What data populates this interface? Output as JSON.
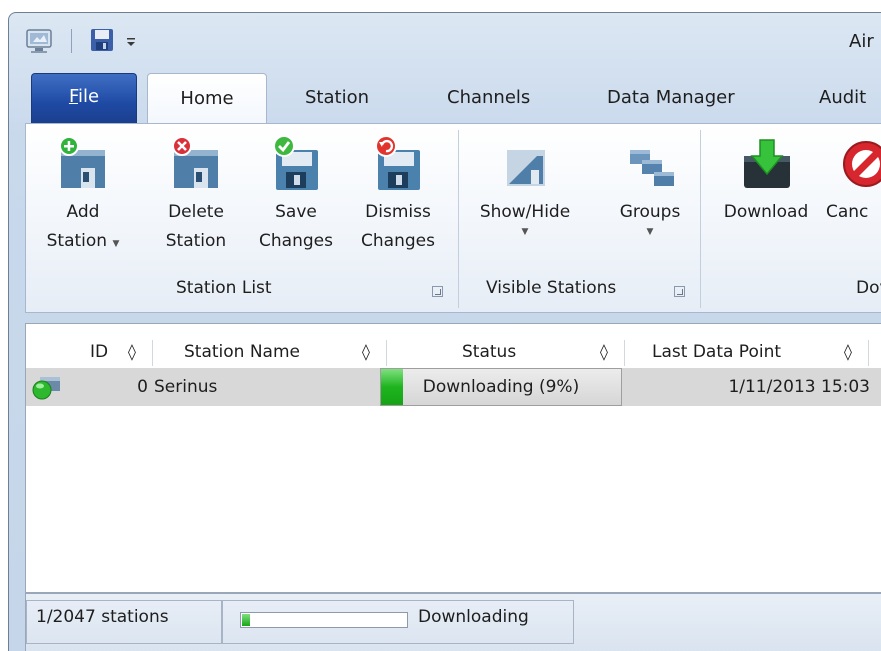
{
  "window": {
    "title": "Air"
  },
  "quick_access": {
    "icons": [
      "computer-icon",
      "save-icon",
      "customize-dropdown-icon"
    ]
  },
  "tabs": [
    {
      "label": "File",
      "underline": "F",
      "rest": "ile"
    },
    {
      "label": "Home",
      "selected": true
    },
    {
      "label": "Station"
    },
    {
      "label": "Channels"
    },
    {
      "label": "Data Manager"
    },
    {
      "label": "Audit"
    }
  ],
  "ribbon": {
    "groups": [
      {
        "label": "Station List",
        "buttons": [
          {
            "line1": "Add",
            "line2": "Station",
            "dropdown": true,
            "icon": "add-station-icon"
          },
          {
            "line1": "Delete",
            "line2": "Station",
            "icon": "delete-station-icon"
          },
          {
            "line1": "Save",
            "line2": "Changes",
            "icon": "save-changes-icon"
          },
          {
            "line1": "Dismiss",
            "line2": "Changes",
            "icon": "dismiss-changes-icon"
          }
        ]
      },
      {
        "label": "Visible Stations",
        "buttons": [
          {
            "line1": "Show/Hide",
            "dropdown": true,
            "icon": "show-hide-icon"
          },
          {
            "line1": "Groups",
            "dropdown": true,
            "icon": "groups-icon"
          }
        ]
      },
      {
        "label": "Dov",
        "buttons": [
          {
            "line1": "Download",
            "icon": "download-icon"
          },
          {
            "line1": "Canc",
            "icon": "cancel-icon"
          }
        ]
      }
    ]
  },
  "grid": {
    "columns": [
      "ID",
      "Station Name",
      "Status",
      "Last Data Point"
    ],
    "sort_glyph": "◊",
    "rows": [
      {
        "id": "0",
        "station_name": "Serinus",
        "status": "Downloading (9%)",
        "progress_percent": 9,
        "last_data_point": "1/11/2013 15:03",
        "status_color": "#2eb82e"
      }
    ]
  },
  "statusbar": {
    "stations": "1/2047 stations",
    "progress_percent": 5,
    "activity": "Downloading"
  },
  "colors": {
    "accent": "#1f4aa4",
    "progress_green": "#1fb41f",
    "ribbon_bg": "#f2f6fb"
  }
}
